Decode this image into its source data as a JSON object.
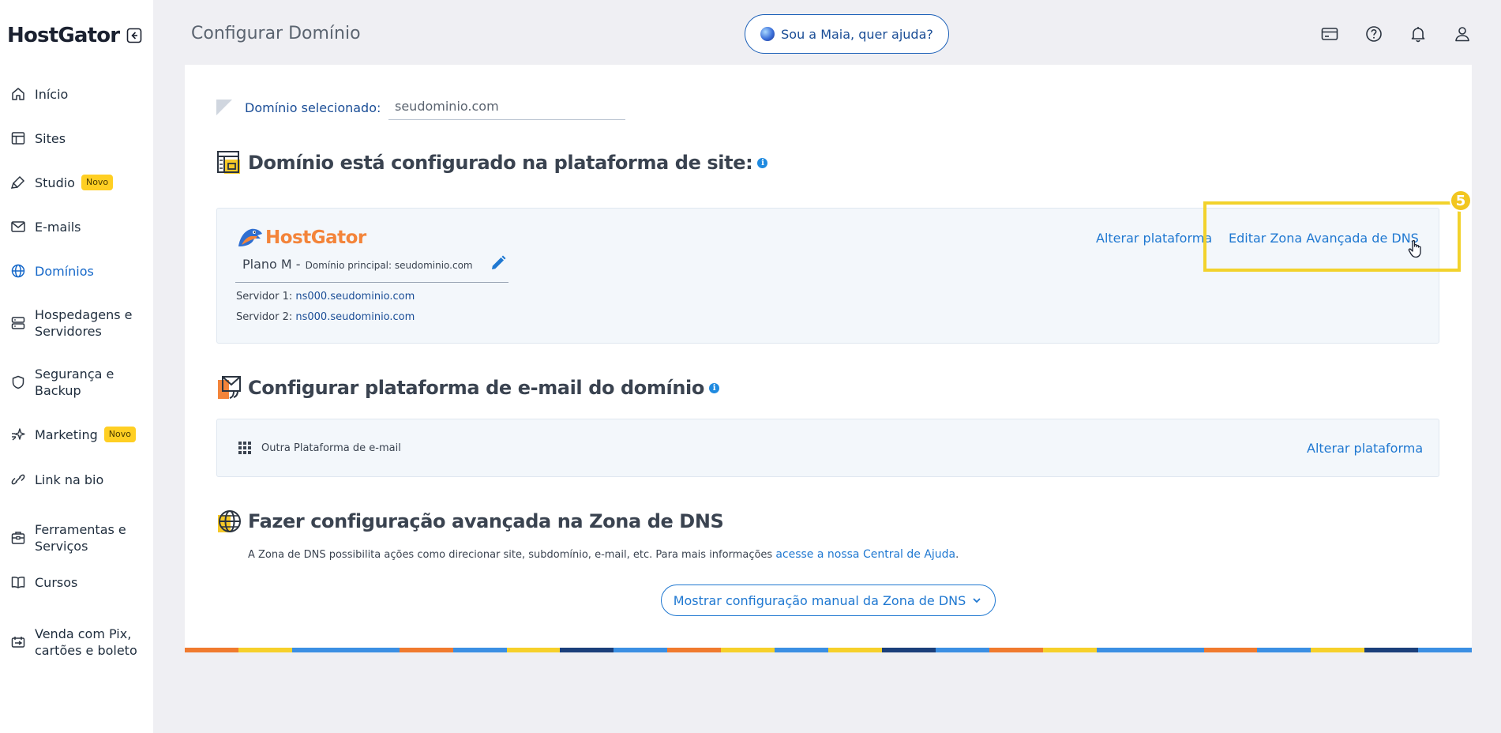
{
  "brand": {
    "name": "HostGator"
  },
  "sidebar": {
    "items": [
      {
        "label": "Início",
        "icon": "home-icon"
      },
      {
        "label": "Sites",
        "icon": "layout-icon"
      },
      {
        "label": "Studio",
        "icon": "paintbrush-icon",
        "badge": "Novo"
      },
      {
        "label": "E-mails",
        "icon": "mail-icon"
      },
      {
        "label": "Domínios",
        "icon": "globe-icon",
        "active": true
      },
      {
        "label": "Hospedagens e\nServidores",
        "icon": "server-icon"
      },
      {
        "label": "Segurança e\nBackup",
        "icon": "shield-icon"
      },
      {
        "label": "Marketing",
        "icon": "sparkle-icon",
        "badge": "Novo"
      },
      {
        "label": "Link na bio",
        "icon": "link-icon"
      },
      {
        "label": "Ferramentas e\nServiços",
        "icon": "toolbox-icon"
      },
      {
        "label": "Cursos",
        "icon": "book-icon"
      },
      {
        "label": "Venda com Pix,\ncartões e boleto",
        "icon": "payment-icon"
      }
    ]
  },
  "header": {
    "title": "Configurar Domínio",
    "assistant_button": "Sou a Maia, quer ajuda?"
  },
  "domain_selector": {
    "label": "Domínio selecionado:",
    "value": "seudominio.com"
  },
  "site_platform": {
    "title": "Domínio está configurado na plataforma de site:",
    "provider": "HostGator",
    "plan": "Plano M -",
    "main_domain": "Domínio principal: seudominio.com",
    "server1_label": "Servidor 1:",
    "server1_value": "ns000.seudominio.com",
    "server2_label": "Servidor 2:",
    "server2_value": "ns000.seudominio.com",
    "change_platform": "Alterar plataforma",
    "edit_dns": "Editar Zona Avançada de DNS"
  },
  "email_platform": {
    "title": "Configurar plataforma de e-mail do domínio",
    "option": "Outra Plataforma de e-mail",
    "change_platform": "Alterar plataforma"
  },
  "dns_zone": {
    "title": "Fazer configuração avançada na Zona de DNS",
    "description": "A Zona de DNS possibilita ações como direcionar site, subdomínio, e-mail, etc. Para mais informações ",
    "help_link": "acesse a nossa Central de Ajuda",
    "description_end": ".",
    "show_button": "Mostrar configuração manual da Zona de DNS"
  },
  "tutorial": {
    "step": "5"
  },
  "colors": {
    "accent": "#1f78d1",
    "highlight": "#f2d22c",
    "brand_orange": "#f3843a",
    "badge_yellow": "#ffcf23",
    "bar_stripes": [
      "#f07a2e",
      "#f6d02a",
      "#3b8fe3",
      "#3b8fe3",
      "#f07a2e",
      "#3b8fe3",
      "#f6d02a",
      "#1b3f7a",
      "#3b8fe3",
      "#f07a2e",
      "#f6d02a",
      "#3b8fe3",
      "#f6d02a",
      "#1b3f7a",
      "#3b8fe3",
      "#f07a2e",
      "#f6d02a",
      "#3b8fe3",
      "#3b8fe3",
      "#f07a2e",
      "#3b8fe3",
      "#f6d02a",
      "#1b3f7a",
      "#3b8fe3"
    ]
  }
}
